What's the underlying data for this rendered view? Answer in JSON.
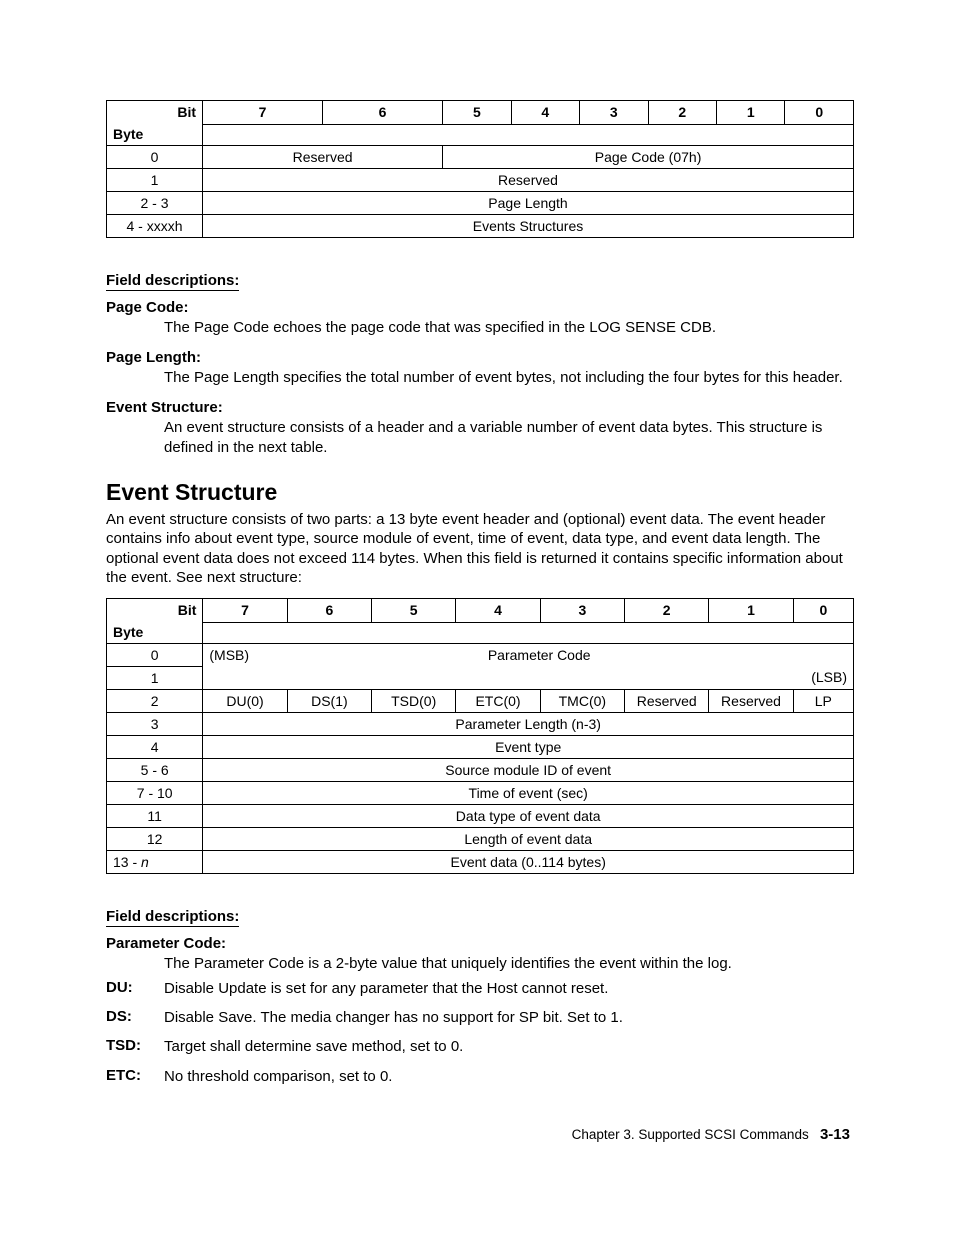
{
  "table1": {
    "bit_label": "Bit",
    "byte_label": "Byte",
    "bits": [
      "7",
      "6",
      "5",
      "4",
      "3",
      "2",
      "1",
      "0"
    ],
    "rows": {
      "r0": {
        "byte": "0",
        "reserved": "Reserved",
        "pagecode": "Page Code (07h)"
      },
      "r1": {
        "byte": "1",
        "reserved": "Reserved"
      },
      "r2": {
        "byte": "2 - 3",
        "label": "Page Length"
      },
      "r3": {
        "byte": "4 - xxxxh",
        "label": "Events Structures"
      }
    }
  },
  "fd1": {
    "heading": "Field descriptions:",
    "page_code_term": "Page Code:",
    "page_code_def": "The Page Code echoes the page code that was specified in the LOG SENSE CDB.",
    "page_length_term": "Page Length:",
    "page_length_def": "The Page Length specifies the total number of event bytes, not including the four bytes for this header.",
    "event_struct_term": "Event Structure:",
    "event_struct_def": "An event structure consists of a header and a variable number of event data bytes. This structure is defined in the next table."
  },
  "evt": {
    "heading": "Event Structure",
    "para": "An event structure consists of two parts: a 13 byte event header and (optional) event data. The event header contains info about event type, source module of event, time of event, data type, and event data length. The optional event data does not exceed 114 bytes. When this field is returned it contains specific information about the event. See next structure:"
  },
  "table2": {
    "bit_label": "Bit",
    "byte_label": "Byte",
    "bits": [
      "7",
      "6",
      "5",
      "4",
      "3",
      "2",
      "1",
      "0"
    ],
    "rows": {
      "r0": {
        "byte": "0",
        "msb": "(MSB)",
        "param": "Parameter Code"
      },
      "r1": {
        "byte": "1",
        "lsb": "(LSB)"
      },
      "r2": {
        "byte": "2",
        "cells": [
          "DU(0)",
          "DS(1)",
          "TSD(0)",
          "ETC(0)",
          "TMC(0)",
          "Reserved",
          "Reserved",
          "LP"
        ]
      },
      "r3": {
        "byte": "3",
        "label": "Parameter Length (n-3)"
      },
      "r4": {
        "byte": "4",
        "label": "Event type"
      },
      "r5": {
        "byte": "5 - 6",
        "label": "Source module ID of event"
      },
      "r6": {
        "byte": "7 - 10",
        "label": "Time of event (sec)"
      },
      "r7": {
        "byte": "11",
        "label": "Data type of event data"
      },
      "r8": {
        "byte": "12",
        "label": "Length of event data"
      },
      "r9": {
        "byte_a": "13 - ",
        "byte_b": "n",
        "label": "Event data (0..114 bytes)"
      }
    }
  },
  "fd2": {
    "heading": "Field descriptions:",
    "pc_term": "Parameter Code:",
    "pc_def": "The Parameter Code is a 2-byte value that uniquely identifies the event within the log.",
    "du_term": "DU:",
    "du_def": "Disable Update is set for any parameter that the Host cannot reset.",
    "ds_term": "DS:",
    "ds_def": "Disable Save. The media changer has no support for SP bit. Set to 1.",
    "tsd_term": "TSD:",
    "tsd_def": "Target shall determine save method, set to 0.",
    "etc_term": "ETC:",
    "etc_def": "No threshold comparison, set to 0."
  },
  "footer": {
    "text": "Chapter 3. Supported SCSI Commands",
    "page": "3-13"
  }
}
